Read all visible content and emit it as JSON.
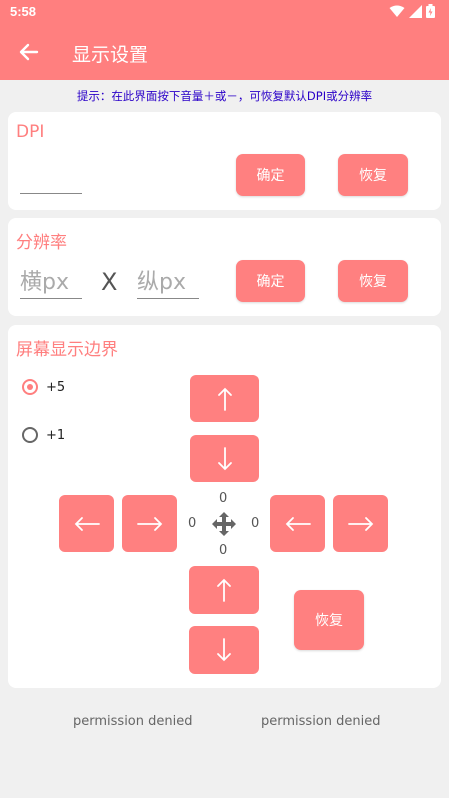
{
  "status": {
    "time": "5:58"
  },
  "appbar": {
    "title": "显示设置"
  },
  "hint": "提示：在此界面按下音量＋或－，可恢复默认DPI或分辨率",
  "dpi": {
    "title": "DPI",
    "value": "",
    "confirm": "确定",
    "restore": "恢复"
  },
  "resolution": {
    "title": "分辨率",
    "width_placeholder": "横px",
    "separator": "X",
    "height_placeholder": "纵px",
    "confirm": "确定",
    "restore": "恢复"
  },
  "border": {
    "title": "屏幕显示边界",
    "step_options": [
      "+5",
      "+1"
    ],
    "selected_step": "+5",
    "top_value": "0",
    "left_value": "0",
    "right_value": "0",
    "bottom_value": "0",
    "restore": "恢复"
  },
  "footer": {
    "left": "permission denied",
    "right": "permission denied"
  },
  "colors": {
    "accent": "#ff7f7f",
    "button": "#ff8080",
    "hint": "#2a00c8"
  }
}
